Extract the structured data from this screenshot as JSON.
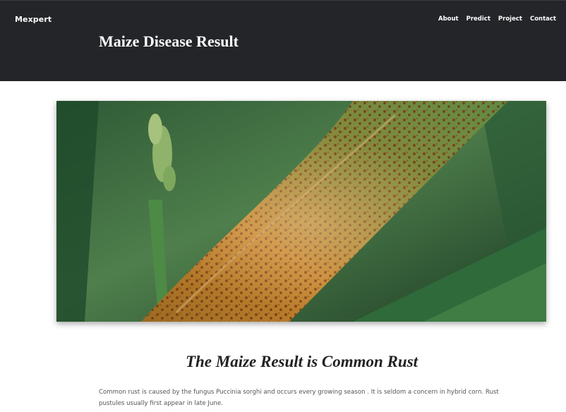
{
  "header": {
    "brand": "Mexpert",
    "nav": [
      "About",
      "Predict",
      "Project",
      "Contact"
    ],
    "title": "Maize Disease Result"
  },
  "result": {
    "heading": "The Maize Result is Common Rust",
    "description": "Common rust is caused by the fungus Puccinia sorghi and occurs every growing season . It is seldom a concern in hybrid corn. Rust pustules usually first appear in late June."
  },
  "colors": {
    "header_bg": "#232528",
    "header_text": "#ffffff",
    "body_text": "#555555",
    "heading_text": "#222222"
  }
}
